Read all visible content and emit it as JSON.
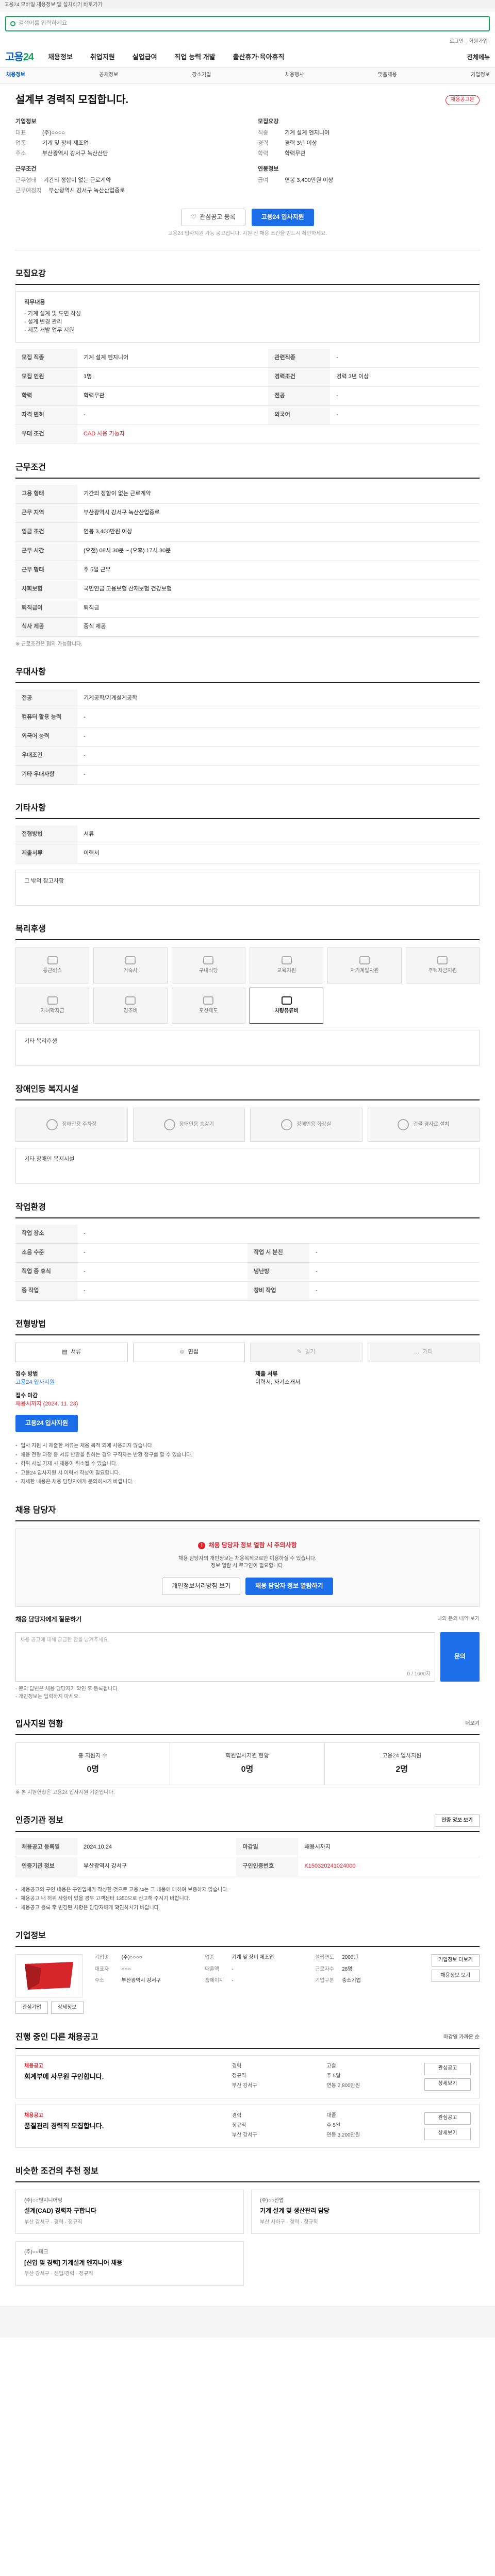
{
  "topbar": {
    "notice": "고용24 모바일 채용정보 앱 설치하기 바로가기"
  },
  "search": {
    "placeholder": "검색어를 입력하세요"
  },
  "util": {
    "login": "로그인",
    "join": "회원가입"
  },
  "gnb": {
    "logo_a": "고용",
    "logo_b": "24",
    "menu": [
      "채용정보",
      "취업지원",
      "실업급여",
      "직업 능력 개발",
      "출산휴가·육아휴직"
    ],
    "right": "전체메뉴"
  },
  "lnb": {
    "items": [
      "채용정보",
      "공채정보",
      "강소기업",
      "채용행사",
      "맞춤채용",
      "기업정보"
    ]
  },
  "job": {
    "title": "설계부 경력직 모집합니다.",
    "badge": "채용공고문",
    "company_head": "기업정보",
    "recruit_head": "모집요강",
    "c_rows": [
      {
        "k": "대표",
        "v": "(주)○○○○"
      },
      {
        "k": "업종",
        "v": "기계 및 장비 제조업"
      },
      {
        "k": "주소",
        "v": "부산광역시 강서구 녹산산단"
      }
    ],
    "r_rows": [
      {
        "k": "직종",
        "v": "기계 설계 엔지니어"
      },
      {
        "k": "경력",
        "v": "경력 3년 이상"
      },
      {
        "k": "학력",
        "v": "학력무관"
      }
    ],
    "grp2_h": "근무조건",
    "g2_rows": [
      {
        "k": "근무형태",
        "v": "기간의 정함이 없는 근로계약"
      },
      {
        "k": "근무예정지",
        "v": "부산광역시 강서구 녹산산업중로"
      }
    ],
    "grp2r_h": "연봉정보",
    "g2r_rows": [
      {
        "k": "급여",
        "v": "연봉 3,400만원 이상"
      }
    ],
    "btn_interest": "관심공고 등록",
    "btn_apply": "고용24 입사지원",
    "notice": "고용24 입사지원 가능 공고입니다. 지원 전 채용 조건을 반드시 확인하세요."
  },
  "recruit": {
    "title": "모집요강",
    "desc_h": "직무내용",
    "desc": [
      "- 기계 설계 및 도면 작성",
      "- 설계 변경 관리",
      "- 제품 개발 업무 지원"
    ],
    "rows": [
      {
        "h": "모집 직종",
        "v": "기계 설계 엔지니어",
        "h2": "관련직종",
        "v2": "-"
      },
      {
        "h": "모집 인원",
        "v": "1명",
        "h2": "경력조건",
        "v2": "경력 3년 이상"
      },
      {
        "h": "학력",
        "v": "학력무관",
        "h2": "전공",
        "v2": "-"
      },
      {
        "h": "자격 면허",
        "v": "-",
        "h2": "외국어",
        "v2": "-"
      },
      {
        "h": "우대 조건",
        "v": "CAD 사용 가능자",
        "h2": "",
        "v2": ""
      }
    ]
  },
  "conditions": {
    "title": "근무조건",
    "rows": [
      {
        "h": "고용 형태",
        "v": "기간의 정함이 없는 근로계약"
      },
      {
        "h": "근무 지역",
        "v": "부산광역시 강서구 녹산산업중로"
      },
      {
        "h": "임금 조건",
        "v": "연봉 3,400만원 이상"
      },
      {
        "h": "근무 시간",
        "v": "(오전) 08시 30분 ~ (오후) 17시 30분"
      },
      {
        "h": "근무 형태",
        "v": "주 5일 근무"
      },
      {
        "h": "사회보험",
        "v": "국민연금 고용보험 산재보험 건강보험"
      },
      {
        "h": "퇴직급여",
        "v": "퇴직금"
      },
      {
        "h": "식사 제공",
        "v": "중식 제공"
      }
    ],
    "footnote": "※ 근로조건은 협의 가능합니다."
  },
  "prefs": {
    "title": "우대사항",
    "rows": [
      {
        "h": "전공",
        "v": "기계공학/기계설계공학"
      },
      {
        "h": "컴퓨터 활용 능력",
        "v": "-"
      },
      {
        "h": "외국어 능력",
        "v": "-"
      },
      {
        "h": "우대조건",
        "v": "-"
      },
      {
        "h": "기타 우대사항",
        "v": "-"
      }
    ]
  },
  "etc": {
    "title": "기타사항",
    "rows": [
      {
        "h": "전형방법",
        "v": "서류"
      },
      {
        "h": "제출서류",
        "v": "이력서"
      }
    ],
    "box": "그 밖의 참고사항"
  },
  "welfare": {
    "title": "복리후생",
    "items": [
      "통근버스",
      "기숙사",
      "구내식당",
      "교육지원",
      "자기계발지원",
      "주택자금지원",
      "자녀학자금",
      "경조비",
      "포상제도",
      "차량유류비"
    ],
    "active_index": 9,
    "box_h": "기타 복리후생"
  },
  "disability": {
    "title": "장애인등 복지시설",
    "items": [
      "장애인용 주차장",
      "장애인용 승강기",
      "장애인용 화장실",
      "건물 경사로 설치"
    ],
    "box_h": "기타 장애인 복지시설"
  },
  "workplace": {
    "title": "작업환경",
    "rows": [
      {
        "h": "작업 장소",
        "v": "-",
        "h2": "",
        "v2": ""
      },
      {
        "h": "소음 수준",
        "v": "-",
        "h2": "작업 시 분진",
        "v2": "-"
      },
      {
        "h": "직업 중 휴식",
        "v": "-",
        "h2": "냉난방",
        "v2": "-"
      },
      {
        "h": "중 작업",
        "v": "-",
        "h2": "장비 작업",
        "v2": "-"
      }
    ]
  },
  "method": {
    "title": "전형방법",
    "items": [
      {
        "label": "서류",
        "on": true
      },
      {
        "label": "면접",
        "on": true
      },
      {
        "label": "필기",
        "on": false
      },
      {
        "label": "기타",
        "on": false
      }
    ],
    "apply_h": "접수 방법",
    "apply_v": "고용24 입사지원",
    "deadline_h": "접수 마감",
    "deadline_v": "채용시까지 (2024. 11. 23)",
    "docs_h": "제출 서류",
    "docs_v": "이력서, 자기소개서",
    "btn": "고용24 입사지원",
    "bullets": [
      "입사 지원 시 제출한 서류는 채용 목적 외에 사용되지 않습니다.",
      "채용 전형 과정 중 서류 반환을 원하는 경우 구직자는 반환 청구를 할 수 있습니다.",
      "허위 사실 기재 시 채용이 취소될 수 있습니다.",
      "고용24 입사지원 시 이력서 작성이 필요합니다.",
      "자세한 내용은 채용 담당자에게 문의하시기 바랍니다."
    ]
  },
  "manager": {
    "title": "채용 담당자",
    "alert": "채용 담당자 정보 열람 시 주의사항",
    "desc1": "채용 담당자의 개인정보는 채용목적으로만 이용하실 수 있습니다.",
    "desc2": "정보 열람 시 로그인이 필요합니다.",
    "btn1": "개인정보처리방침 보기",
    "btn2": "채용 담당자 정보 열람하기",
    "q_h": "채용 담당자에게 질문하기",
    "q_right": "나의 문의 내역 보기",
    "placeholder": "채용 공고에 대해 궁금한 점을 남겨주세요.",
    "count": "0 / 1000자",
    "q_btn": "문의",
    "notes": [
      "- 문의 답변은 채용 담당자가 확인 후 등록됩니다.",
      "- 개인정보는 입력하지 마세요."
    ]
  },
  "stats": {
    "title": "입사지원 현황",
    "more": "더보기",
    "items": [
      {
        "lbl": "총 지원자 수",
        "num": "0명"
      },
      {
        "lbl": "회원입사지원 현황",
        "num": "0명"
      },
      {
        "lbl": "고용24 입사지원",
        "num": "2명"
      }
    ],
    "note": "※ 본 지원현황은 고용24 입사지원 기준입니다."
  },
  "info": {
    "title": "인증기관 정보",
    "btn": "인증 정보 보기",
    "rows": [
      {
        "h": "채용공고 등록일",
        "v": "2024.10.24",
        "h2": "마감일",
        "v2": "채용시까지"
      },
      {
        "h": "인증기관 정보",
        "v": "부산광역시 강서구",
        "h2": "구인인증번호",
        "v2": "K150320241024000"
      }
    ],
    "bullets": [
      "채용공고의 구인 내용은 구인업체가 작성한 것으로 고용24는 그 내용에 대하여 보증하지 않습니다.",
      "채용공고 내 허위 사항이 있을 경우 고객센터 1350으로 신고해 주시기 바랍니다.",
      "채용공고 등록 후 변경된 사항은 담당자에게 확인하시기 바랍니다."
    ]
  },
  "company": {
    "title": "기업정보",
    "btn_interest": "관심기업",
    "btn_more": "기업정보 더보기",
    "btn_list": "채용정보 보기",
    "btn_detail": "상세정보",
    "info": [
      {
        "k": "기업명",
        "v": "(주)○○○○"
      },
      {
        "k": "업종",
        "v": "기계 및 장비 제조업"
      },
      {
        "k": "설립연도",
        "v": "2006년"
      },
      {
        "k": "대표자",
        "v": "○○○"
      },
      {
        "k": "매출액",
        "v": "-"
      },
      {
        "k": "근로자수",
        "v": "28명"
      },
      {
        "k": "주소",
        "v": "부산광역시 강서구"
      },
      {
        "k": "홈페이지",
        "v": "-"
      },
      {
        "k": "기업구분",
        "v": "중소기업"
      }
    ]
  },
  "others": {
    "title": "진행 중인 다른 채용공고",
    "right": "마감일 가까운 순",
    "cards": [
      {
        "co": "채용공고",
        "title": "회계부에 사무원 구인합니다.",
        "tags": [
          "경력",
          "고졸",
          "정규직",
          "주 5일",
          "부산 강서구",
          "연봉 2,800만원"
        ],
        "btn1": "관심공고",
        "btn2": "상세보기"
      },
      {
        "co": "채용공고",
        "title": "품질관리 경력직 모집합니다.",
        "tags": [
          "경력",
          "대졸",
          "정규직",
          "주 5일",
          "부산 강서구",
          "연봉 3,200만원"
        ],
        "btn1": "관심공고",
        "btn2": "상세보기"
      }
    ]
  },
  "recent": {
    "title": "비슷한 조건의 추천 정보",
    "cards": [
      {
        "co": "(주)○○엔지니어링",
        "title": "설계(CAD) 경력자 구합니다",
        "tags": "부산 강서구 · 경력 · 정규직"
      },
      {
        "co": "(주)○○산업",
        "title": "기계 설계 및 생산관리 담당",
        "tags": "부산 사하구 · 경력 · 정규직"
      },
      {
        "co": "(주)○○테크",
        "title": "[신입 및 경력] 기계설계 엔지니어 채용",
        "tags": "부산 강서구 · 신입/경력 · 정규직"
      }
    ]
  }
}
